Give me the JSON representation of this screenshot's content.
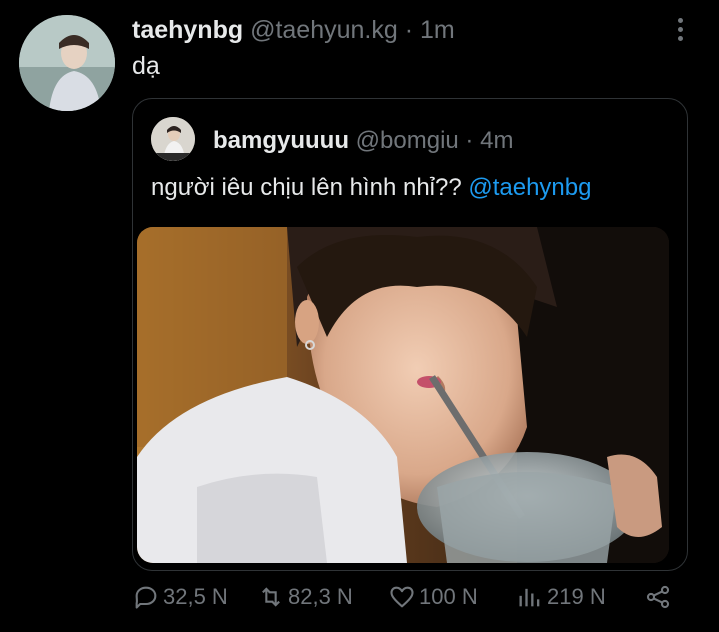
{
  "tweet": {
    "display_name": "taehynbg",
    "handle": "@taehyun.kg",
    "separator": "·",
    "time": "1m",
    "text": "dạ"
  },
  "quoted_tweet": {
    "display_name": "bamgyuuuu",
    "handle": "@bomgiu",
    "separator": "·",
    "time": "4m",
    "text": "người iêu chịu lên hình nhỉ?? ",
    "mention": "@taehynbg"
  },
  "actions": {
    "reply_count": "32,5 N",
    "retweet_count": "82,3 N",
    "like_count": "100 N",
    "views_count": "219 N"
  },
  "icons": {
    "more": "more-icon",
    "reply": "reply-icon",
    "retweet": "retweet-icon",
    "like": "heart-icon",
    "views": "views-icon",
    "share": "share-icon"
  },
  "colors": {
    "background": "#000000",
    "text": "#e7e9ea",
    "muted": "#71767b",
    "link": "#1d9bf0",
    "border": "#2f3336"
  }
}
